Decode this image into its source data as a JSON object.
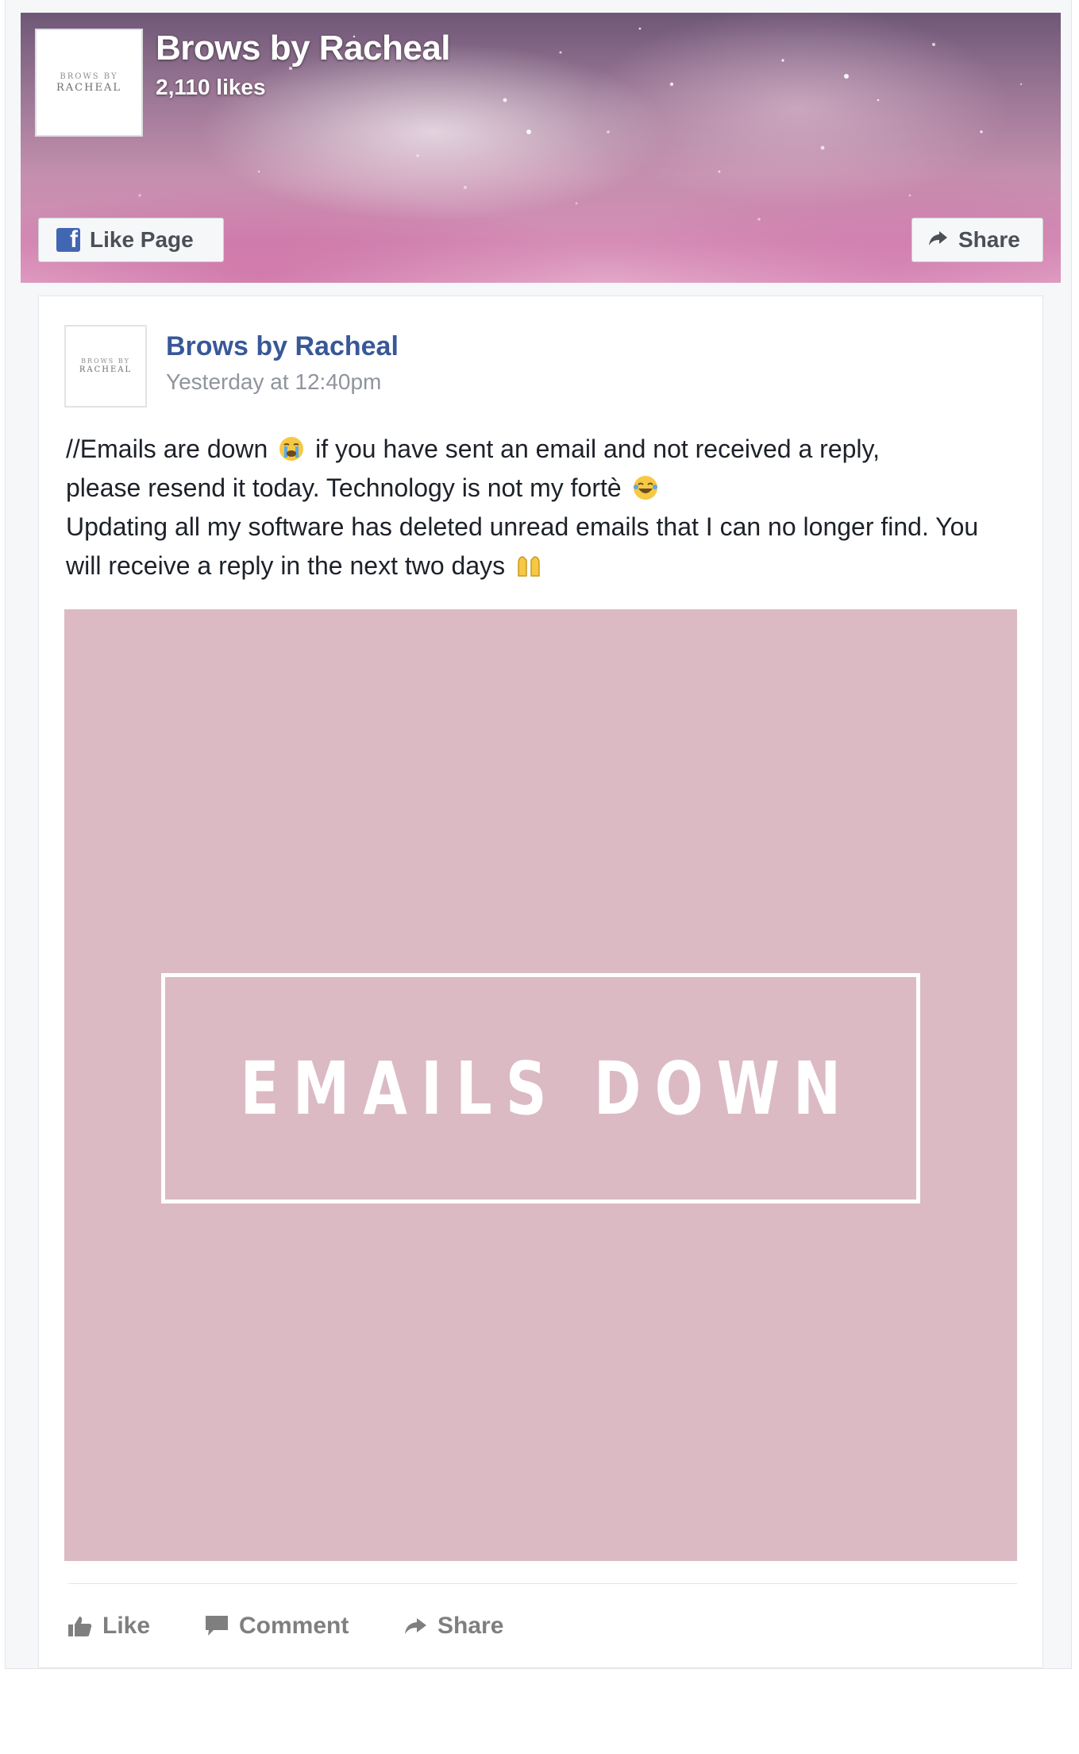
{
  "page": {
    "name": "Brows by Racheal",
    "likes": "2,110 likes",
    "logo_text": [
      "BROWS BY",
      "RACHEAL"
    ]
  },
  "cover_buttons": {
    "like_page": "Like Page",
    "share": "Share"
  },
  "post": {
    "author": "Brows by Racheal",
    "timestamp": "Yesterday at 12:40pm",
    "text_lines": [
      "//Emails are down",
      "if you have sent an email and not received a reply,",
      "please resend it today. Technology is not my fortè",
      "Updating all my software has deleted unread emails that I can no longer find. You will receive a reply in the next two days"
    ],
    "image": {
      "caption": "EMAILS DOWN",
      "background": "#dbbac4",
      "frame_color": "#ffffff"
    },
    "actions": {
      "like": "Like",
      "comment": "Comment",
      "share": "Share"
    }
  },
  "icons": {
    "facebook": "facebook-icon",
    "share": "share-arrow-icon",
    "like": "thumbs-up-icon",
    "comment": "comment-bubble-icon",
    "crying": "crying-face-emoji",
    "laughing": "tears-of-joy-emoji",
    "hands": "raised-hands-emoji"
  },
  "colors": {
    "link_blue": "#385898",
    "meta_gray": "#90949c",
    "fb_blue": "#4267b2"
  }
}
